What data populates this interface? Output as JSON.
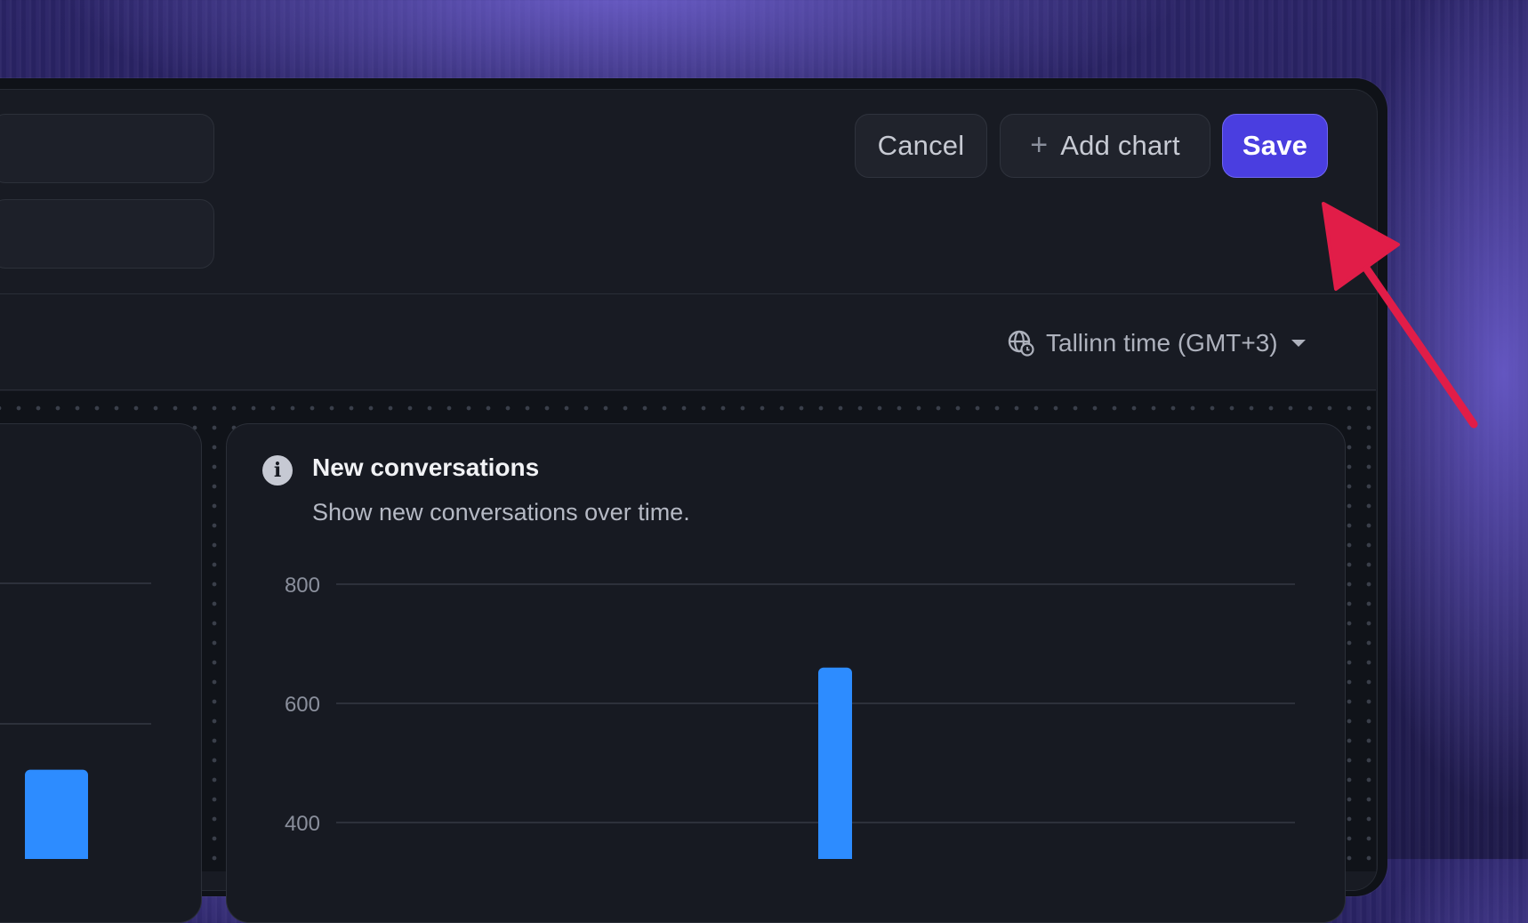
{
  "toolbar": {
    "cancel_label": "Cancel",
    "add_chart_label": "Add chart",
    "save_label": "Save"
  },
  "timezone": {
    "label": "Tallinn time (GMT+3)"
  },
  "card": {
    "title": "New conversations",
    "subtitle": "Show new conversations over time."
  },
  "colors": {
    "primary": "#4a3ee0",
    "bar": "#2d8cff",
    "annotation_arrow": "#e11d48"
  },
  "icons": {
    "info": "info-icon",
    "globe": "globe-clock-icon",
    "caret": "caret-down-icon",
    "plus": "plus-icon"
  },
  "chart_data": [
    {
      "type": "bar",
      "title": "",
      "y_ticks": [],
      "values": [
        {
          "x": "",
          "y": 560
        }
      ]
    },
    {
      "type": "bar",
      "title": "New conversations",
      "subtitle": "Show new conversations over time.",
      "ylim": [
        400,
        800
      ],
      "y_ticks": [
        "800",
        "600",
        "400"
      ],
      "values": [
        {
          "x": "",
          "y": 660
        }
      ]
    }
  ]
}
